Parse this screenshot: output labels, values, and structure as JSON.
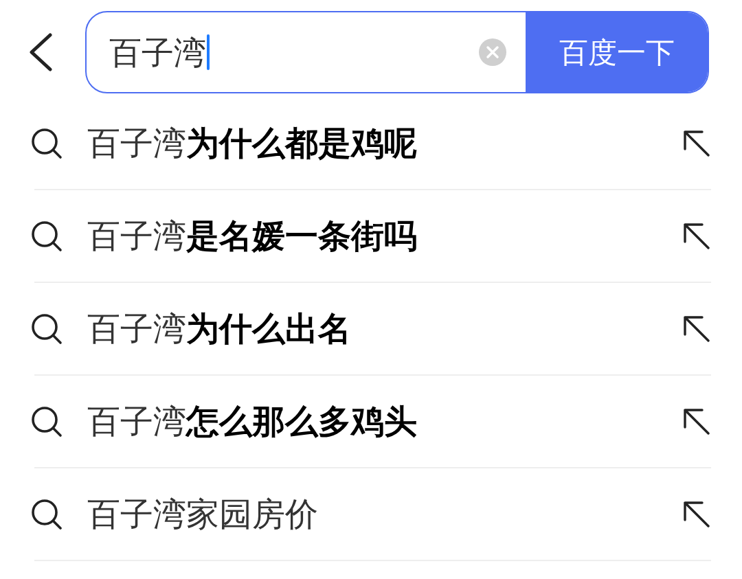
{
  "search": {
    "value": "百子湾",
    "focused": true,
    "button": "百度一下"
  },
  "suggestions": [
    {
      "text": "百子湾**为什么都是鸡呢**"
    },
    {
      "text": "百子湾**是名媛一条街吗**"
    },
    {
      "text": "百子湾**为什么出名**"
    },
    {
      "text": "百子湾**怎么那么多鸡头**"
    },
    {
      "text": "百子湾家园房价"
    }
  ]
}
